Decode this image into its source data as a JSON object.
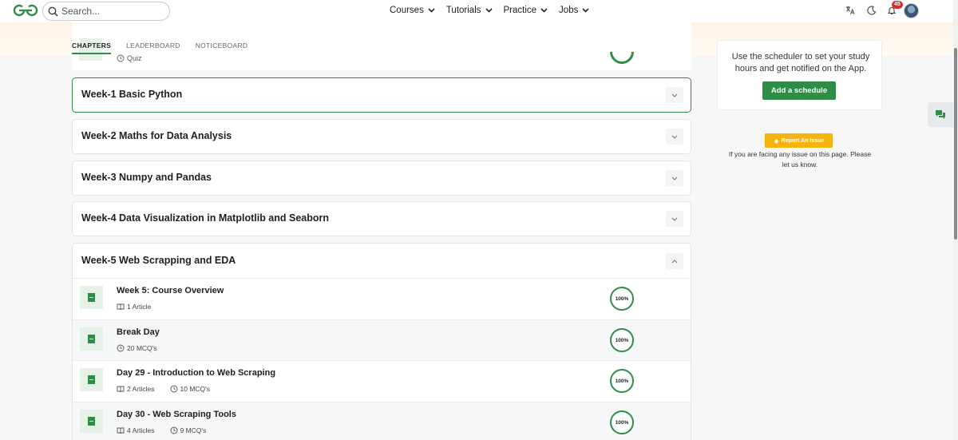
{
  "header": {
    "search_placeholder": "Search...",
    "nav": [
      "Courses",
      "Tutorials",
      "Practice",
      "Jobs"
    ],
    "notification_count": "45"
  },
  "tabs": [
    "CHAPTERS",
    "LEADERBOARD",
    "NOTICEBOARD"
  ],
  "previous_item": {
    "meta": "Quiz"
  },
  "weeks": [
    "Week-1 Basic Python",
    "Week-2 Maths for Data Analysis",
    "Week-3 Numpy and Pandas",
    "Week-4 Data Visualization in Matplotlib and Seaborn",
    "Week-5 Web Scrapping and EDA"
  ],
  "lessons": [
    {
      "title": "Week 5: Course Overview",
      "articles": "1 Article",
      "mcqs": "",
      "progress": "100%"
    },
    {
      "title": "Break Day",
      "articles": "",
      "mcqs": "20 MCQ's",
      "progress": "100%"
    },
    {
      "title": "Day 29 - Introduction to Web Scraping",
      "articles": "2 Articles",
      "mcqs": "10 MCQ's",
      "progress": "100%"
    },
    {
      "title": "Day 30 - Web Scraping Tools",
      "articles": "4 Articles",
      "mcqs": "9 MCQ's",
      "progress": "100%"
    }
  ],
  "sidebar": {
    "schedule_text": "Use the scheduler to set your study hours and get notified on the App.",
    "schedule_button": "Add a schedule",
    "report_button": "Report An Issue",
    "report_text": "If you are facing any issue on this page. Please let us know."
  },
  "colors": {
    "accent": "#2f8d46",
    "report": "#f6b40f",
    "badge": "#d32f2f"
  },
  "icons": [
    "gfg-logo",
    "search-icon",
    "chevron-down-icon",
    "translate-icon",
    "moon-icon",
    "bell-icon",
    "book-icon",
    "clock-icon",
    "chevron-up-icon",
    "chat-icon"
  ]
}
